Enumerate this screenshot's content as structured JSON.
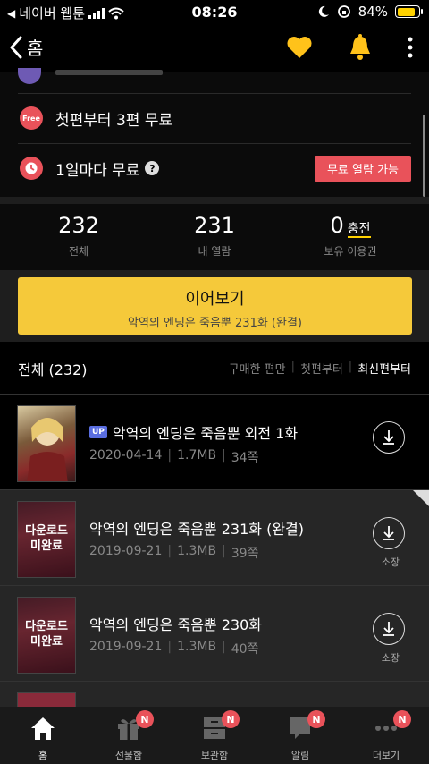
{
  "status": {
    "carrier": "네이버 웹툰",
    "time": "08:26",
    "battery": "84%"
  },
  "header": {
    "back_label": "홈"
  },
  "info": {
    "free_badge": "Free",
    "free_text": "첫편부터 3편 무료",
    "wait_text": "1일마다 무료",
    "help": "?",
    "unlock_button": "무료 열람 가능"
  },
  "stats": {
    "total_num": "232",
    "total_label": "전체",
    "read_num": "231",
    "read_label": "내 열람",
    "ticket_num": "0",
    "ticket_charge": "충전",
    "ticket_label": "보유 이용권"
  },
  "continue": {
    "title": "이어보기",
    "subtitle": "악역의 엔딩은 죽음뿐 231화 (완결)"
  },
  "list": {
    "header": "전체 (232)",
    "sort_purchased": "구매한 편만",
    "sort_first": "첫편부터",
    "sort_latest": "최신편부터"
  },
  "episodes": [
    {
      "badge": "UP",
      "title": "악역의 엔딩은 죽음뿐 외전 1화",
      "date": "2020-04-14",
      "size": "1.7MB",
      "pages": "34쪽",
      "download_label": ""
    },
    {
      "thumb_line1": "다운로드",
      "thumb_line2": "미완료",
      "title": "악역의 엔딩은 죽음뿐 231화 (완결)",
      "date": "2019-09-21",
      "size": "1.3MB",
      "pages": "39쪽",
      "download_label": "소장"
    },
    {
      "thumb_line1": "다운로드",
      "thumb_line2": "미완료",
      "title": "악역의 엔딩은 죽음뿐 230화",
      "date": "2019-09-21",
      "size": "1.3MB",
      "pages": "40쪽",
      "download_label": "소장"
    }
  ],
  "nav": [
    {
      "label": "홈",
      "badge": ""
    },
    {
      "label": "선물함",
      "badge": "N"
    },
    {
      "label": "보관함",
      "badge": "N"
    },
    {
      "label": "알림",
      "badge": "N"
    },
    {
      "label": "더보기",
      "badge": "N"
    }
  ],
  "colors": {
    "accent_yellow": "#f5c93a",
    "accent_red": "#e9525a",
    "up_badge": "#5a6ee0"
  }
}
